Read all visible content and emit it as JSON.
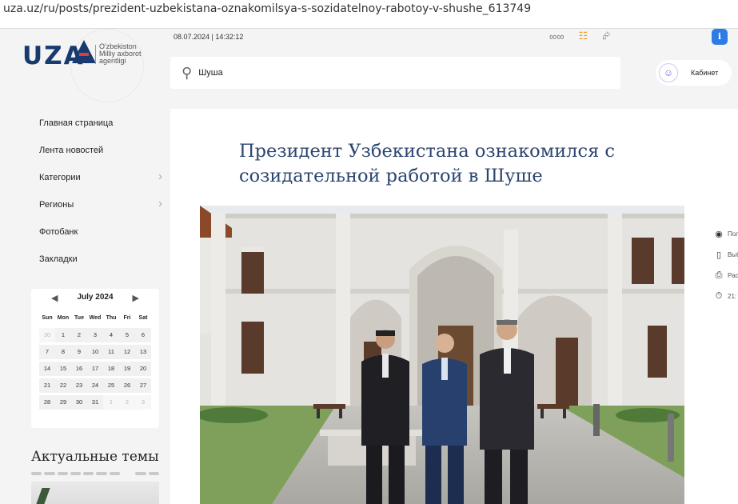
{
  "browser": {
    "url": "uza.uz/ru/posts/prezident-uzbekistana-oznakomilsya-s-sozidatelnoy-rabotoy-v-shushe_613749"
  },
  "header": {
    "logo_word": "UZA",
    "logo_sub_1": "O'zbekiston",
    "logo_sub_2": "Milliy axborot",
    "logo_sub_3": "agentligi",
    "datetime": "08.07.2024 | 14:32:12",
    "icons": [
      "glasses-icon",
      "rss-icon",
      "share-icon"
    ],
    "lang_badge": "ℹ",
    "cabinet_label": "Кабинет"
  },
  "search": {
    "value": "Шуша",
    "placeholder": ""
  },
  "nav": {
    "items": [
      {
        "label": "Главная страница",
        "has_arrow": false
      },
      {
        "label": "Лента новостей",
        "has_arrow": false
      },
      {
        "label": "Категории",
        "has_arrow": true
      },
      {
        "label": "Регионы",
        "has_arrow": true
      },
      {
        "label": "Фотобанк",
        "has_arrow": false
      },
      {
        "label": "Закладки",
        "has_arrow": false
      }
    ]
  },
  "calendar": {
    "month_label": "July 2024",
    "weekdays": [
      "Sun",
      "Mon",
      "Tue",
      "Wed",
      "Thu",
      "Fri",
      "Sat"
    ],
    "days": [
      {
        "d": "30",
        "muted": true
      },
      {
        "d": "1"
      },
      {
        "d": "2"
      },
      {
        "d": "3"
      },
      {
        "d": "4"
      },
      {
        "d": "5"
      },
      {
        "d": "6"
      },
      {
        "d": "7"
      },
      {
        "d": "8"
      },
      {
        "d": "9"
      },
      {
        "d": "10"
      },
      {
        "d": "11"
      },
      {
        "d": "12"
      },
      {
        "d": "13"
      },
      {
        "d": "14"
      },
      {
        "d": "15"
      },
      {
        "d": "16"
      },
      {
        "d": "17"
      },
      {
        "d": "18"
      },
      {
        "d": "19"
      },
      {
        "d": "20"
      },
      {
        "d": "21"
      },
      {
        "d": "22"
      },
      {
        "d": "23"
      },
      {
        "d": "24"
      },
      {
        "d": "25"
      },
      {
        "d": "26"
      },
      {
        "d": "27"
      },
      {
        "d": "28"
      },
      {
        "d": "29"
      },
      {
        "d": "30"
      },
      {
        "d": "31"
      },
      {
        "d": "1",
        "muted": true
      },
      {
        "d": "2",
        "muted": true
      },
      {
        "d": "3",
        "muted": true
      }
    ]
  },
  "topics": {
    "title": "Актуальные темы"
  },
  "article": {
    "title": "Президент Узбекистана ознакомился с созидательной работой в Шуше"
  },
  "side_tools": [
    {
      "icon": "radio-icon",
      "label": "Пол"
    },
    {
      "icon": "bookmark-icon",
      "label": "Выб"
    },
    {
      "icon": "print-icon",
      "label": "Рас"
    },
    {
      "icon": "timer-icon",
      "label": "21:"
    }
  ],
  "colors": {
    "brand": "#173a70",
    "title": "#2b4570",
    "accent": "#2d7be5",
    "rss": "#f59a1b"
  }
}
